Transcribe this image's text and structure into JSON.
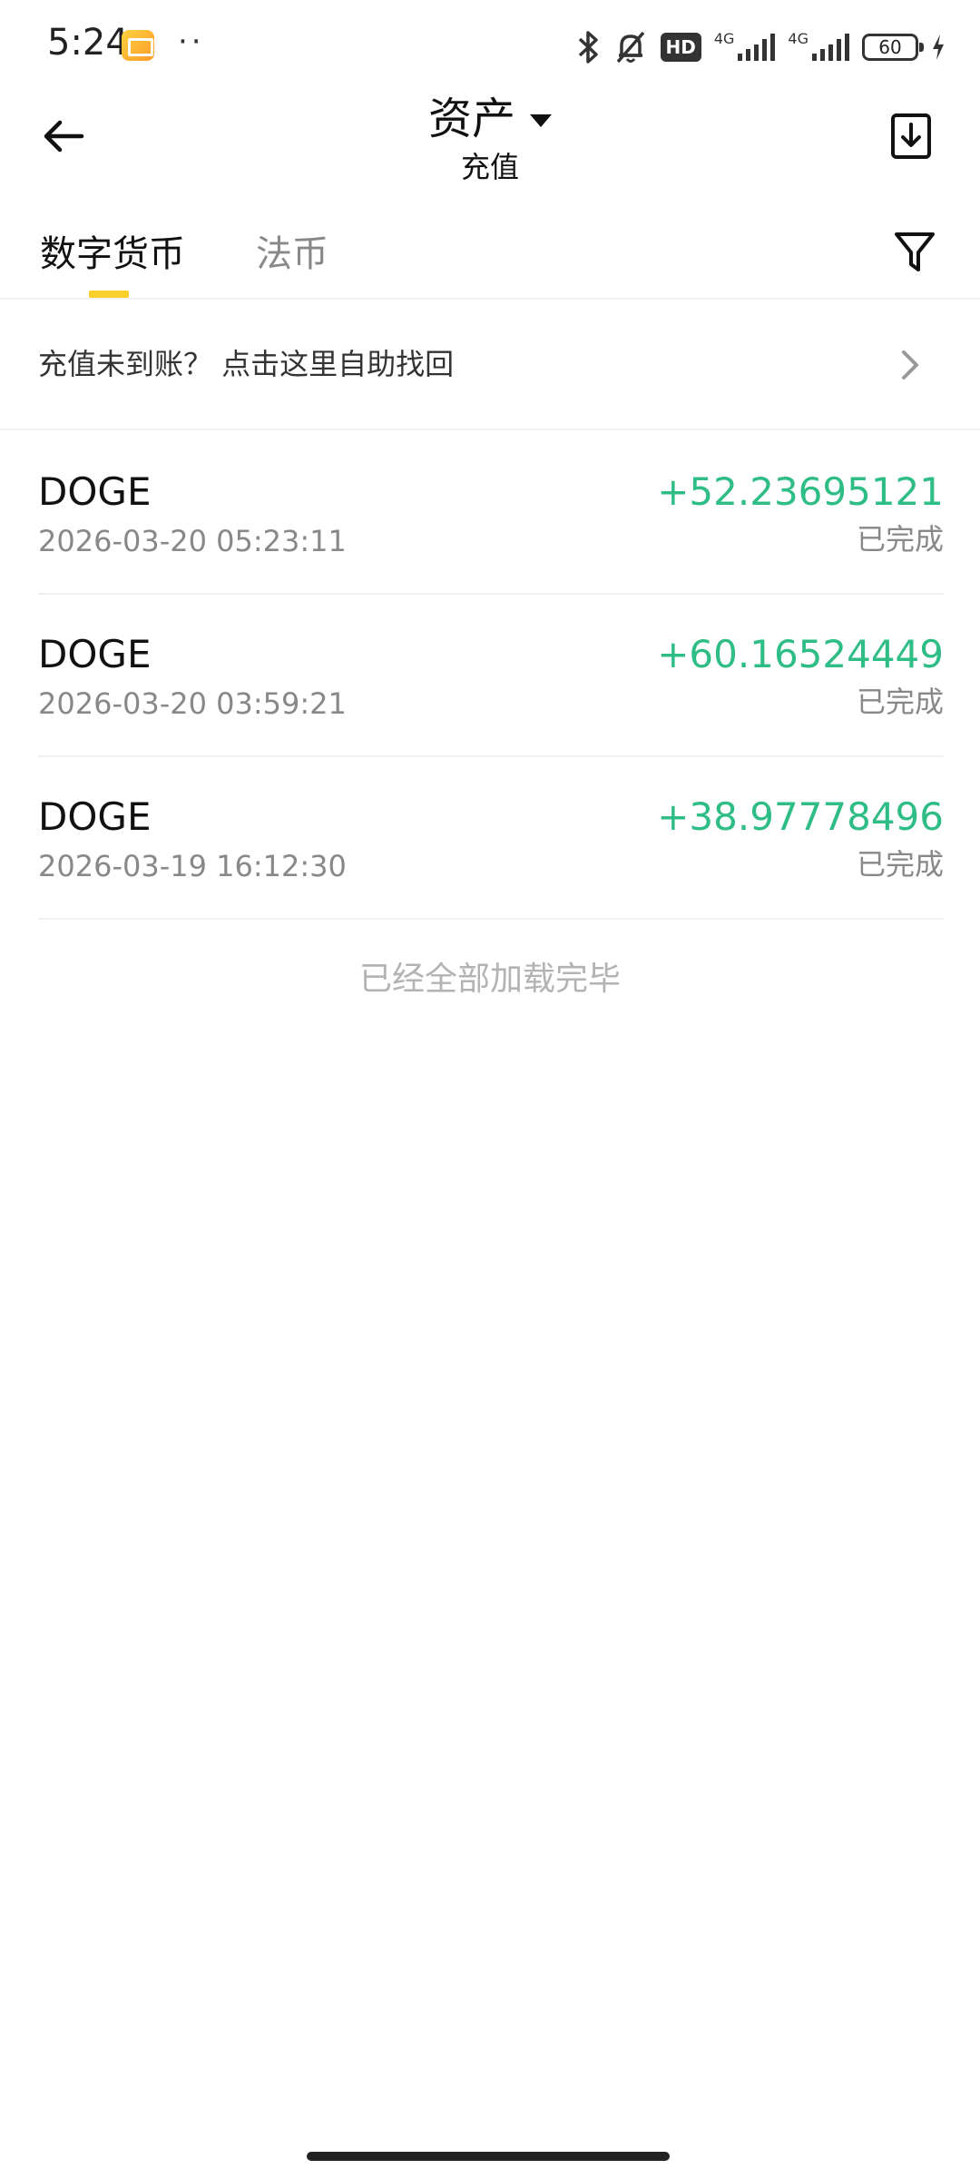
{
  "status_bar": {
    "time": "5:24",
    "dots": "··",
    "hd_label": "HD",
    "net1": "4G",
    "net2": "4G",
    "battery": "60"
  },
  "header": {
    "title": "资产",
    "subtitle": "充值"
  },
  "tabs": [
    {
      "label": "数字货币",
      "active": true
    },
    {
      "label": "法币",
      "active": false
    }
  ],
  "help": {
    "text": "充值未到账？ 点击这里自助找回"
  },
  "records": [
    {
      "coin": "DOGE",
      "time": "2026-03-20 05:23:11",
      "amount": "+52.23695121",
      "status": "已完成"
    },
    {
      "coin": "DOGE",
      "time": "2026-03-20 03:59:21",
      "amount": "+60.16524449",
      "status": "已完成"
    },
    {
      "coin": "DOGE",
      "time": "2026-03-19 16:12:30",
      "amount": "+38.97778496",
      "status": "已完成"
    }
  ],
  "end_text": "已经全部加载完毕",
  "colors": {
    "accent": "#f9cf2b",
    "positive": "#2ebd85",
    "muted": "#888888"
  }
}
